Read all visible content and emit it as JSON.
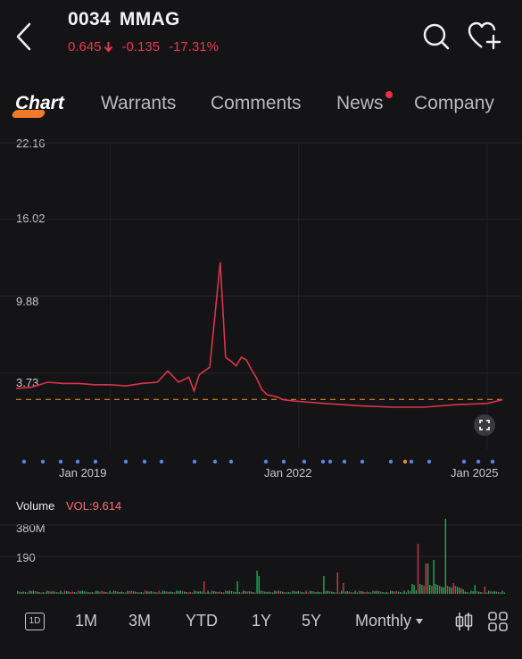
{
  "header": {
    "code": "0034",
    "name": "MMAG",
    "price": "0.645",
    "change": "-0.135",
    "change_pct": "-17.31%",
    "down_color": "#e8394f"
  },
  "tabs": [
    {
      "label": "Chart",
      "active": true
    },
    {
      "label": "Warrants"
    },
    {
      "label": "Comments"
    },
    {
      "label": "News",
      "badge": true
    },
    {
      "label": "Company"
    }
  ],
  "chart": {
    "y_ticks": [
      "22.16",
      "16.02",
      "9.88",
      "3.73"
    ],
    "x_ticks": [
      "Jan 2019",
      "Jan 2022",
      "Jan 2025"
    ],
    "line_color": "#d9344c",
    "ref_line_color": "#c9741f"
  },
  "volume": {
    "label": "Volume",
    "vol_text": "VOL:9.614",
    "y_ticks": [
      "380M",
      "190"
    ]
  },
  "periods": [
    "1M",
    "3M",
    "YTD",
    "1Y",
    "5Y"
  ],
  "interval": "Monthly",
  "interval_indicator": "1D",
  "icons": [
    "back-icon",
    "search-icon",
    "favorite-add-icon",
    "candlestick-icon",
    "grid-icon",
    "fullscreen-icon"
  ],
  "chart_data": {
    "type": "line",
    "x": [
      "2017-07",
      "2017-10",
      "2018-01",
      "2018-04",
      "2018-07",
      "2018-10",
      "2019-01",
      "2019-04",
      "2019-07",
      "2019-10",
      "2019-12",
      "2020-02",
      "2020-04",
      "2020-05",
      "2020-06",
      "2020-08",
      "2020-10",
      "2020-11",
      "2020-12",
      "2021-01",
      "2021-02",
      "2021-03",
      "2021-04",
      "2021-05",
      "2021-06",
      "2021-07",
      "2021-08",
      "2021-09",
      "2021-10",
      "2021-12",
      "2022-06",
      "2023-01",
      "2023-07",
      "2024-01",
      "2024-07",
      "2025-01",
      "2025-04"
    ],
    "y": [
      2.5,
      2.6,
      3.0,
      2.9,
      2.9,
      2.8,
      2.8,
      2.7,
      2.9,
      3.0,
      3.9,
      3.0,
      3.4,
      2.3,
      3.6,
      4.2,
      12.6,
      5.0,
      4.7,
      4.3,
      5.0,
      4.8,
      4.0,
      3.3,
      2.4,
      2.0,
      1.9,
      1.8,
      1.6,
      1.5,
      1.3,
      1.1,
      1.0,
      1.0,
      1.2,
      1.3,
      1.6
    ],
    "reference_value": 1.62,
    "ylim": [
      0,
      22.16
    ],
    "y_ticks": [
      3.73,
      9.88,
      16.02,
      22.16
    ],
    "x_tick_labels": [
      "Jan 2019",
      "Jan 2022",
      "Jan 2025"
    ]
  }
}
